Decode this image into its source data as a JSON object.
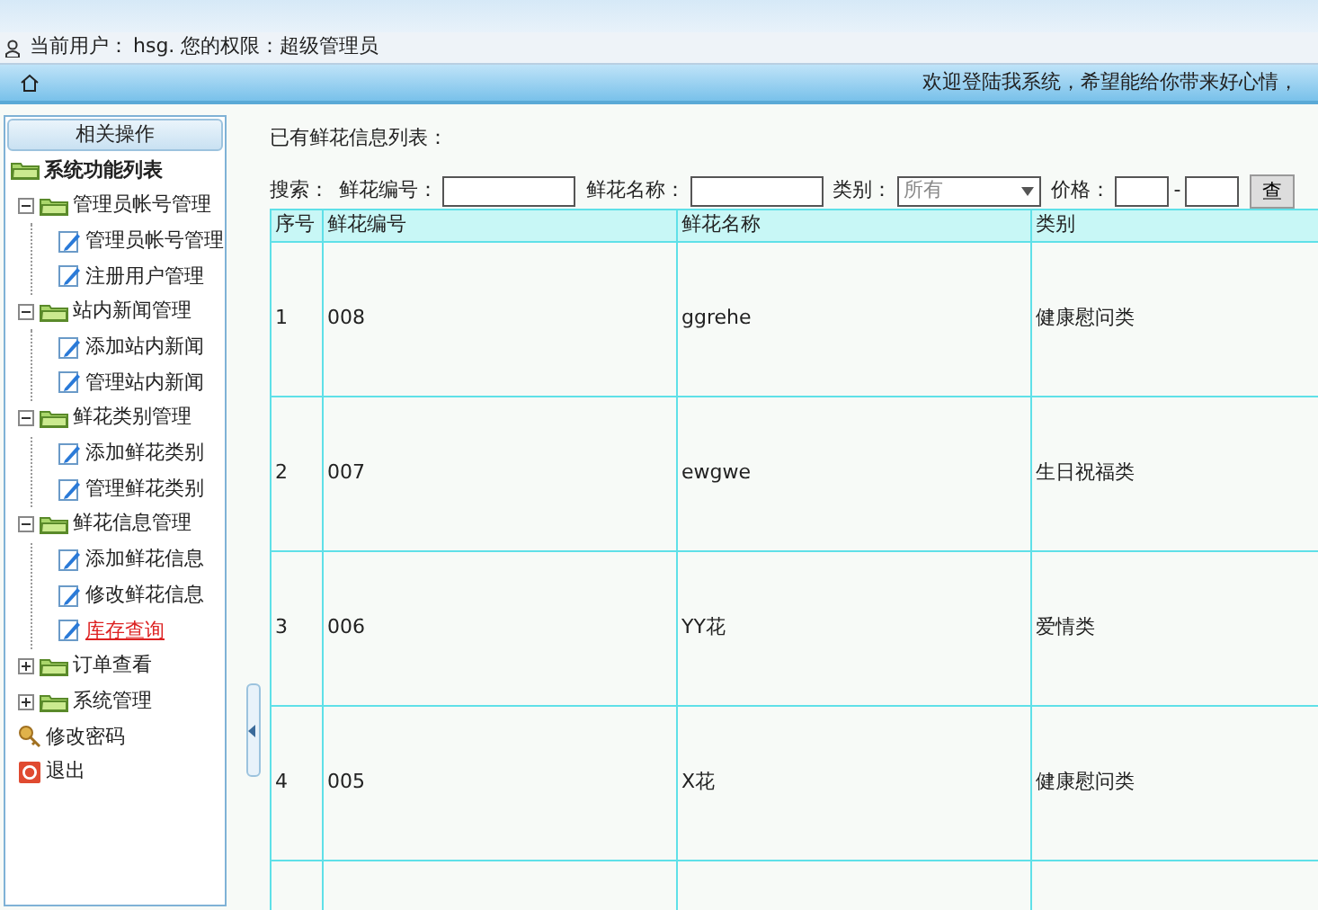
{
  "user_bar": {
    "label": "当前用户：",
    "info": "hsg. 您的权限：超级管理员"
  },
  "nav_bar": {
    "welcome": "欢迎登陆我系统，希望能给你带来好心情，"
  },
  "sidebar": {
    "title": "相关操作",
    "tree": {
      "label": "系统功能列表",
      "kind": "folder",
      "children": [
        {
          "label": "管理员帐号管理",
          "kind": "folder",
          "expanded": true,
          "children": [
            {
              "label": "管理员帐号管理",
              "kind": "page",
              "selected": false
            },
            {
              "label": "注册用户管理",
              "kind": "page",
              "selected": false
            }
          ]
        },
        {
          "label": "站内新闻管理",
          "kind": "folder",
          "expanded": true,
          "children": [
            {
              "label": "添加站内新闻",
              "kind": "page",
              "selected": false
            },
            {
              "label": "管理站内新闻",
              "kind": "page",
              "selected": false
            }
          ]
        },
        {
          "label": "鲜花类别管理",
          "kind": "folder",
          "expanded": true,
          "children": [
            {
              "label": "添加鲜花类别",
              "kind": "page",
              "selected": false
            },
            {
              "label": "管理鲜花类别",
              "kind": "page",
              "selected": false
            }
          ]
        },
        {
          "label": "鲜花信息管理",
          "kind": "folder",
          "expanded": true,
          "children": [
            {
              "label": "添加鲜花信息",
              "kind": "page",
              "selected": false
            },
            {
              "label": "修改鲜花信息",
              "kind": "page",
              "selected": false
            },
            {
              "label": "库存查询",
              "kind": "page",
              "selected": true
            }
          ]
        },
        {
          "label": "订单查看",
          "kind": "folder",
          "expanded": false
        },
        {
          "label": "系统管理",
          "kind": "folder",
          "expanded": false
        },
        {
          "label": "修改密码",
          "kind": "key"
        },
        {
          "label": "退出",
          "kind": "exit"
        }
      ]
    }
  },
  "content": {
    "heading": "已有鲜花信息列表：",
    "search": {
      "label": "搜索：",
      "fields": [
        {
          "kind": "text",
          "label": "鲜花编号："
        },
        {
          "kind": "text",
          "label": "鲜花名称："
        },
        {
          "kind": "select",
          "label": "类别：",
          "value": "所有"
        },
        {
          "kind": "range",
          "label": "价格：",
          "separator": "-"
        }
      ],
      "button": "查"
    },
    "table": {
      "columns": [
        "序号",
        "鲜花编号",
        "鲜花名称",
        "类别"
      ],
      "rows": [
        [
          "1",
          "008",
          "ggrehe",
          "健康慰问类"
        ],
        [
          "2",
          "007",
          "ewgwe",
          "生日祝福类"
        ],
        [
          "3",
          "006",
          "YY花",
          "爱情类"
        ],
        [
          "4",
          "005",
          "X花",
          "健康慰问类"
        ]
      ]
    }
  }
}
